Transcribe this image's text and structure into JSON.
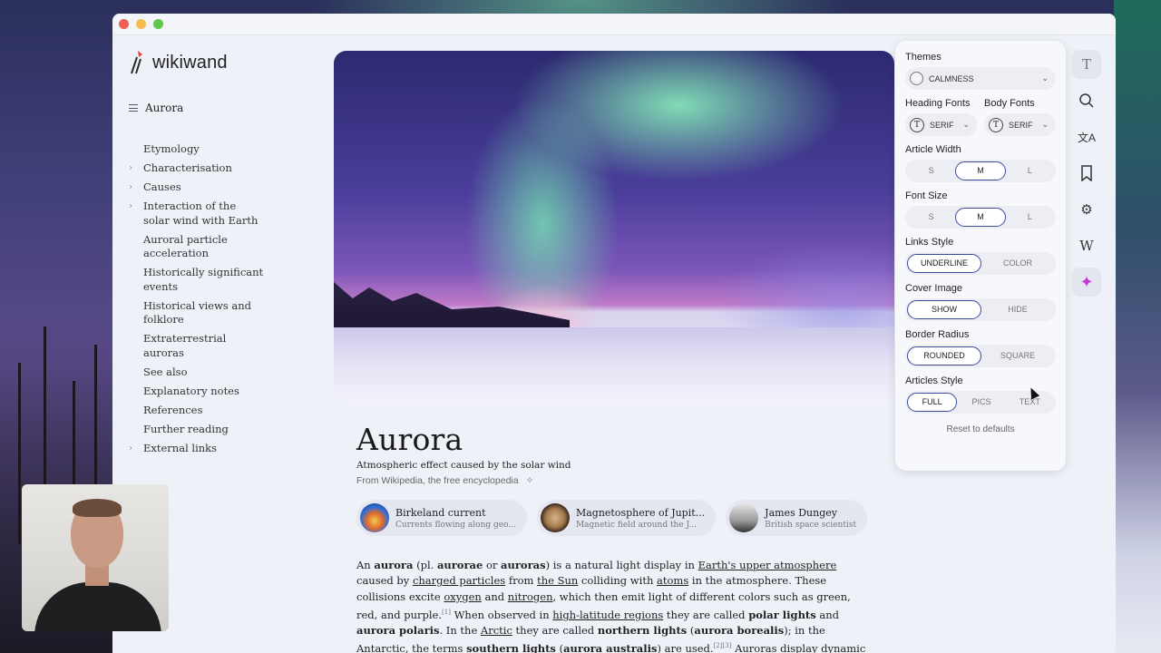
{
  "brand": {
    "name": "wikiwand"
  },
  "toc": {
    "title": "Aurora",
    "items": [
      {
        "label": "Etymology",
        "expandable": false
      },
      {
        "label": "Characterisation",
        "expandable": true
      },
      {
        "label": "Causes",
        "expandable": true
      },
      {
        "label": "Interaction of the solar wind with Earth",
        "expandable": true
      },
      {
        "label": "Auroral particle acceleration",
        "expandable": false
      },
      {
        "label": "Historically significant events",
        "expandable": false
      },
      {
        "label": "Historical views and folklore",
        "expandable": false
      },
      {
        "label": "Extraterrestrial auroras",
        "expandable": false
      },
      {
        "label": "See also",
        "expandable": false
      },
      {
        "label": "Explanatory notes",
        "expandable": false
      },
      {
        "label": "References",
        "expandable": false
      },
      {
        "label": "Further reading",
        "expandable": false
      },
      {
        "label": "External links",
        "expandable": true
      }
    ]
  },
  "article": {
    "title": "Aurora",
    "subtitle": "Atmospheric effect caused by the solar wind",
    "source": "From Wikipedia, the free encyclopedia",
    "related": [
      {
        "title": "Birkeland current",
        "subtitle": "Currents flowing along geo..."
      },
      {
        "title": "Magnetosphere of Jupit...",
        "subtitle": "Magnetic field around the J..."
      },
      {
        "title": "James Dungey",
        "subtitle": "British space scientist"
      }
    ],
    "paragraph": {
      "p1": "An ",
      "b_aurora": "aurora",
      "p2": " (pl. ",
      "b_aurorae": "aurorae",
      "p3": " or ",
      "b_auroras": "auroras",
      "p4": ") is a natural light display in ",
      "l_upper": "Earth's upper atmosphere",
      "p5": " caused by ",
      "l_charged": "charged particles",
      "p6": " from ",
      "l_sun": "the Sun",
      "p7": " colliding with ",
      "l_atoms": "atoms",
      "p8": " in the atmosphere. These collisions excite ",
      "l_oxygen": "oxygen",
      "p9": " and ",
      "l_nitrogen": "nitrogen",
      "p10": ", which then emit light of different colors such as green, red, and purple.",
      "sup1": "[1]",
      "p11": " When observed in ",
      "l_highlat": "high-latitude regions",
      "p12": " they are called ",
      "b_polar": "polar lights",
      "p13": " and ",
      "b_polaris": "aurora polaris",
      "p14": ". In the ",
      "l_arctic": "Arctic",
      "p15": " they are called ",
      "b_northern": "northern lights",
      "p16": " (",
      "b_borealis": "aurora borealis",
      "p17": "); in the ",
      "l_antarctic": "Antarctic",
      "p18": ", the terms ",
      "b_southern": "southern lights",
      "p19": " (",
      "b_australis": "aurora australis",
      "p20": ") are",
      "p21": "used.",
      "sup2": "[2]",
      "sup3": "[3]",
      "p22": " Auroras display dynamic patterns of radiant light that appear as curtains, rays, spirals or"
    }
  },
  "settings": {
    "themes": {
      "label": "Themes",
      "value": "CALMNESS"
    },
    "heading_fonts": {
      "label": "Heading Fonts",
      "value": "SERIF"
    },
    "body_fonts": {
      "label": "Body Fonts",
      "value": "SERIF"
    },
    "article_width": {
      "label": "Article Width",
      "options": [
        "S",
        "M",
        "L"
      ],
      "selected": "M"
    },
    "font_size": {
      "label": "Font Size",
      "options": [
        "S",
        "M",
        "L"
      ],
      "selected": "M"
    },
    "links_style": {
      "label": "Links Style",
      "options": [
        "UNDERLINE",
        "COLOR"
      ],
      "selected": "UNDERLINE"
    },
    "cover_image": {
      "label": "Cover Image",
      "options": [
        "SHOW",
        "HIDE"
      ],
      "selected": "SHOW"
    },
    "border_radius": {
      "label": "Border Radius",
      "options": [
        "ROUNDED",
        "SQUARE"
      ],
      "selected": "ROUNDED"
    },
    "articles_style": {
      "label": "Articles Style",
      "options": [
        "FULL",
        "PICS",
        "TEXT"
      ],
      "selected": "FULL"
    },
    "reset_label": "Reset to defaults",
    "font_glyph": "T"
  },
  "toolbar": {
    "items": [
      {
        "icon": "text-style-icon",
        "glyph": "T",
        "active": true
      },
      {
        "icon": "search-icon",
        "glyph": "⌕",
        "active": false
      },
      {
        "icon": "translate-icon",
        "glyph": "文A",
        "active": false
      },
      {
        "icon": "bookmark-icon",
        "glyph": "⊓",
        "active": false
      },
      {
        "icon": "gear-icon",
        "glyph": "⚙",
        "active": false
      },
      {
        "icon": "wikipedia-icon",
        "glyph": "W",
        "active": false
      },
      {
        "icon": "ai-sparkle-icon",
        "glyph": "✦",
        "active": false
      }
    ]
  },
  "colors": {
    "accent": "#3b4a9a",
    "sparkle": "#c43bd1",
    "window_bg": "#eef1f7"
  }
}
